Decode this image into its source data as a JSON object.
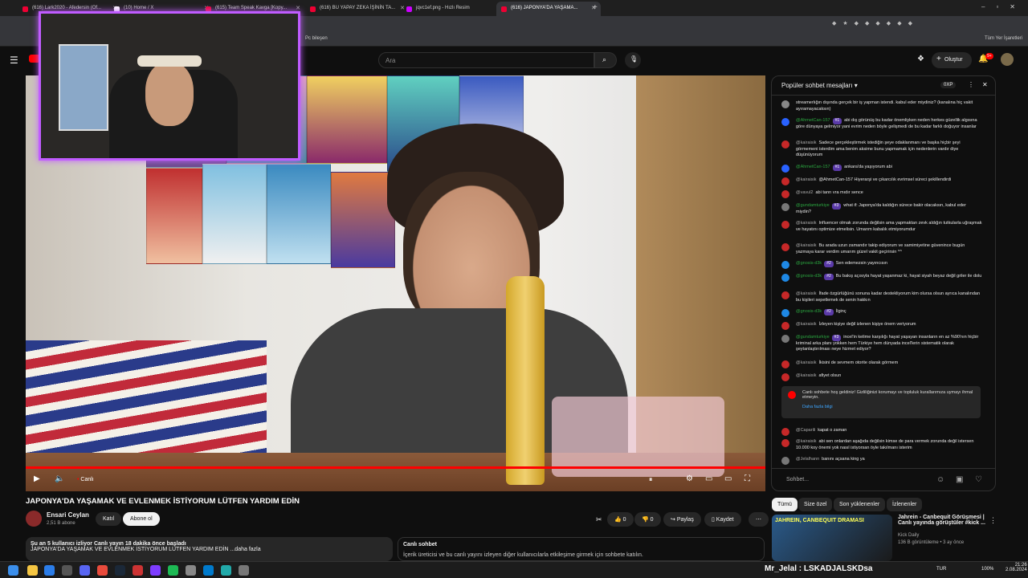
{
  "browser": {
    "tabs": [
      {
        "label": "(616) Lark2020 - Afedersin (Of..."
      },
      {
        "label": "(10) Home / X"
      },
      {
        "label": "(615) Team Speak Kavga [Kopy..."
      },
      {
        "label": "(616) BU YAPAY ZEKA İŞİNİN TA..."
      },
      {
        "label": "jqvc1ef.png - Hızlı Resim"
      },
      {
        "label": "(616) JAPONYA'DA YAŞAMA..."
      }
    ],
    "bookmarks": [
      "Pc bileşen",
      "Tüm Yer İşaretleri"
    ]
  },
  "youtube_header": {
    "search_placeholder": "Ara",
    "create_label": "Oluştur",
    "notif_count": "9+"
  },
  "video": {
    "live_label": "Canlı",
    "accent_color": "#ff0000",
    "title": "JAPONYA'DA YAŞAMAK VE EVLENMEK İSTİYORUM LÜTFEN YARDIM EDİN",
    "channel_name": "Ensari Ceylan",
    "subscribers": "2,51 B abone",
    "join_label": "Katıl",
    "subscribe_label": "Abone ol",
    "likes": "0",
    "dislikes": "0",
    "share_label": "Paylaş",
    "save_label": "Kaydet",
    "desc_line1": "Şu an 5 kullanıcı izliyor  Canlı yayın 18 dakika önce başladı",
    "desc_line2": "JAPONYA'DA YAŞAMAK VE EVLENMEK İSTİYORUM LÜTFEN YARDIM EDİN ...daha fazla",
    "livechat_title": "Canlı sohbet",
    "livechat_text": "İçerik üreticisi ve bu canlı yayını izleyen diğer kullanıcılarla etkileşime girmek için sohbete katılın."
  },
  "chat": {
    "header": "Popüler sohbet mesajları",
    "points": "0XP",
    "messages": [
      {
        "author": "",
        "badge": "",
        "text": "streamerlığın dışında gerçek bir iş yapman istendi. kabul eder miydiniz? (kanalına hiç vakit ayıramayacaksın)",
        "color": "#888888"
      },
      {
        "author": "@AhmetCan-157",
        "badge": "#1",
        "text": "abi dış görünüş bu kadar önemliyken neden herkes güzellik algısına göre dünyaya gelmiyor yani evrim neden böyle gelişmedi de bu kadar farklı doğuyor insanlar",
        "color": "#2962ff"
      },
      {
        "author": "@kairaisik",
        "badge": "",
        "text": "Sadece gerçekleştirmek istediğin şeye odaklanmanı ve başka hiçbir şeyi görmemeni isterdim ama benim aksime bunu yapmamak için nedenlerin vardır diye düşünüyorum",
        "color": "#c62828"
      },
      {
        "author": "@AhmetCan-157",
        "badge": "#1",
        "text": "ankara'da yaşıyorum abi",
        "color": "#2962ff"
      },
      {
        "author": "@kairaisik",
        "badge": "",
        "text": "@AhmetCan-157 Hiyerarşi ve çıkarcılık evrimsel süreci şekillendirdi",
        "color": "#c62828"
      },
      {
        "author": "@vavul2",
        "badge": "",
        "text": "abi tanrı vra mıdır sence",
        "color": "#c62828"
      },
      {
        "author": "@gundamturkiye",
        "badge": "#3",
        "text": "what if: Japonya'da kaldığın sürece bakir olacaksın, kabul eder miydin?",
        "color": "#777777"
      },
      {
        "author": "@kairaisik",
        "badge": "",
        "text": "Influencer olmak zorunda değilsin ama yapmaktan zevk aldığın tutkularla uğraşmak ve hayatını optimize etmelisin. Umarım kabalık etmiyorumdur",
        "color": "#c62828"
      },
      {
        "author": "@kairaisik",
        "badge": "",
        "text": "Bu arada uzun zamandır takip ediyorum ve samimiyetine güvenince bugün yazmaya karar verdim umarım güzel vakit geçirirsin ^^",
        "color": "#c62828"
      },
      {
        "author": "@gnosis-d3k",
        "badge": "#2",
        "text": "Sen edemezsin yayıncısın",
        "color": "#1e88e5"
      },
      {
        "author": "@gnosis-d3k",
        "badge": "#2",
        "text": "Bu bakış açısıyla hayat yaşanmaz ki, hayat siyah beyaz değil griler ile dolu",
        "color": "#1e88e5"
      },
      {
        "author": "@kairaisik",
        "badge": "",
        "text": "İfade özgürlüğünü sonuna kadar destekliyorum kim olursa olsun ayrıca kanalından bu kişileri sepetlemek de senin hakkın",
        "color": "#c62828"
      },
      {
        "author": "@gnosis-d3k",
        "badge": "#2",
        "text": "İlginç",
        "color": "#1e88e5"
      },
      {
        "author": "@kairaisik",
        "badge": "",
        "text": "İzleyen kişiye değil izlenen kişiye önem veriyorum",
        "color": "#c62828"
      },
      {
        "author": "@gundamturkiye",
        "badge": "#3",
        "text": "incel'in kelime karşılığı hayat yaşayan insanların en az %90'nın hiçbir kriminal arka planı yokken hem Türkiye hem dünyada incel'lerin sistematik olarak şeytanlaştırılması neye hizmet ediyor?",
        "color": "#777777"
      },
      {
        "author": "@kairaisik",
        "badge": "",
        "text": "İkisini de sevmem otorite olarak görmem",
        "color": "#c62828"
      },
      {
        "author": "@kairaisik",
        "badge": "",
        "text": "afiyet olsun",
        "color": "#c62828"
      }
    ],
    "notice_text": "Canlı sohbete hoş geldiniz! Gizliliğinizi korumayı ve topluluk kurallarımıza uymayı ihmal etmeyin.",
    "notice_link": "Daha fazla bilgi",
    "after": [
      {
        "author": "@Caparili",
        "badge": "",
        "text": "kapat o zaman",
        "color": "#c62828"
      },
      {
        "author": "@kairaisik",
        "badge": "",
        "text": "abi sen onlardan aşağıda değilsin kimse de para vermek zorunda değil istersen 10.000 koy önemi yok nasıl istiyorsan öyle takılmanı isterim",
        "color": "#c62828"
      },
      {
        "author": "@Jelalhann",
        "badge": "",
        "text": "banını açsana king ya",
        "color": "#777777"
      }
    ],
    "input_placeholder": "Sohbet..."
  },
  "related": {
    "chips": [
      "Tümü",
      "Size özel",
      "Son yüklenenler",
      "İzlenenler"
    ],
    "item": {
      "title": "Jahrein - Canbequit Görüşmesi | Canlı yayında görüştüler #kick ...",
      "channel": "Kick Daily",
      "meta": "136 B görüntüleme • 3 ay önce",
      "thumb_text": "JAHREIN, CANBEQUIT DRAMASI"
    }
  },
  "taskbar": {
    "ticker": "Mr_Jelal : LSKADJALSKDsa",
    "lang": "TUR",
    "battery": "100%",
    "time": "21:26",
    "date": "2.08.2024"
  }
}
